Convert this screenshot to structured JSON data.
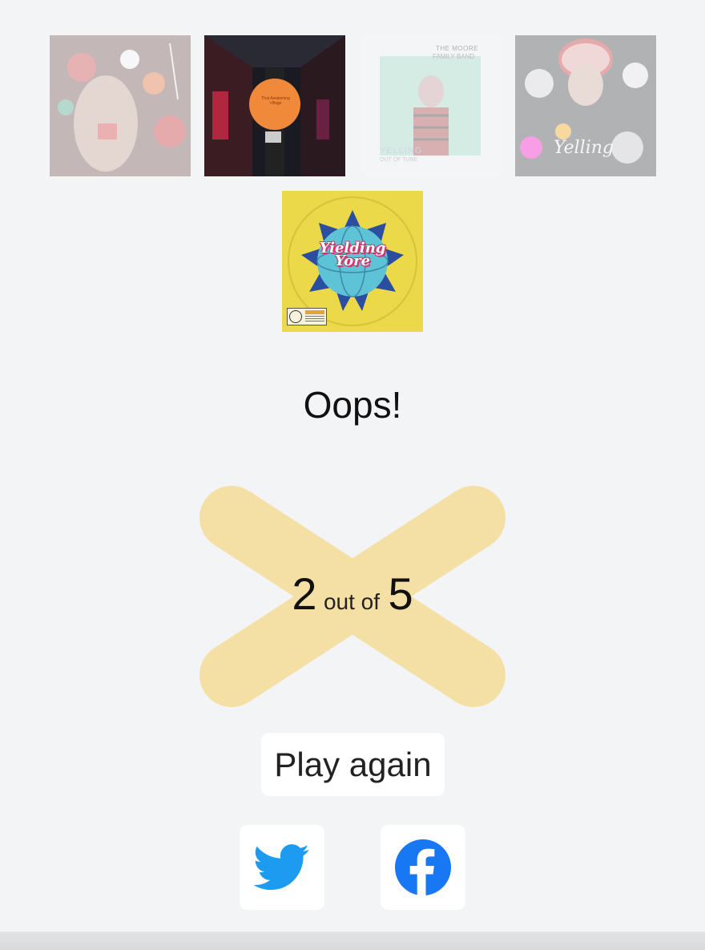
{
  "covers": [
    {
      "name": "cover-1",
      "faded": true,
      "text": []
    },
    {
      "name": "cover-2",
      "faded": false,
      "text": [
        "That Awakening Village"
      ]
    },
    {
      "name": "cover-3",
      "faded": true,
      "text": [
        "THE MOORE",
        "FAMILY BAND",
        "YELLING",
        "OUT OF TUNE"
      ]
    },
    {
      "name": "cover-4",
      "faded": true,
      "text": [
        "Yelling"
      ]
    },
    {
      "name": "cover-5",
      "faded": false,
      "text": [
        "Yielding Yore"
      ]
    }
  ],
  "cover2": {
    "label": "That Awakening Village"
  },
  "cover3": {
    "artist": "THE MOORE",
    "band": "FAMILY BAND",
    "title": "YELLING",
    "subtitle": "OUT OF TUNE"
  },
  "cover4": {
    "title": "Yelling"
  },
  "cover5": {
    "title_line1": "Yielding",
    "title_line2": "Yore"
  },
  "result": {
    "headline": "Oops!",
    "score": "2",
    "connector": "out of",
    "total": "5"
  },
  "actions": {
    "play_again": "Play again"
  },
  "share": [
    {
      "name": "twitter-share-button",
      "icon": "twitter-icon",
      "color": "#1d9bf0"
    },
    {
      "name": "facebook-share-button",
      "icon": "facebook-icon",
      "color": "#1877f2"
    }
  ],
  "colors": {
    "background": "#f3f4f6",
    "cross": "#f5d98c"
  }
}
